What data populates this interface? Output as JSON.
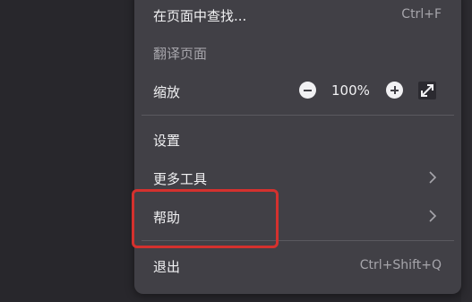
{
  "menu": {
    "find": {
      "label": "在页面中查找...",
      "shortcut": "Ctrl+F"
    },
    "translate": {
      "label": "翻译页面"
    },
    "zoom": {
      "label": "缩放",
      "value": "100%",
      "minus_icon": "zoom-out-icon",
      "plus_icon": "zoom-in-icon",
      "fullscreen_icon": "fullscreen-icon"
    },
    "settings": {
      "label": "设置"
    },
    "more_tools": {
      "label": "更多工具",
      "icon": "chevron-right-icon"
    },
    "help": {
      "label": "帮助",
      "icon": "chevron-right-icon"
    },
    "quit": {
      "label": "退出",
      "shortcut": "Ctrl+Shift+Q"
    }
  },
  "annotation": {
    "color": "#d4312e"
  }
}
